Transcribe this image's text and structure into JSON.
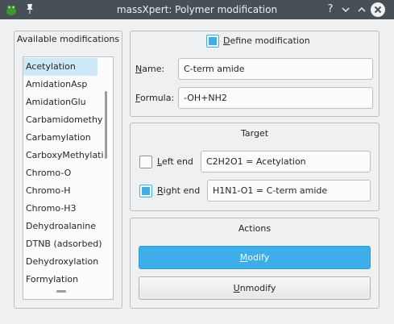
{
  "window": {
    "title": "massXpert: Polymer modification",
    "help_glyph": "?",
    "minimize_glyph": "⌄",
    "maximize_glyph": "⌃",
    "close_glyph": "✕"
  },
  "available": {
    "title": "Available modifications",
    "items": [
      {
        "label": "Acetylation",
        "selected": true
      },
      {
        "label": "AmidationAsp",
        "selected": false
      },
      {
        "label": "AmidationGlu",
        "selected": false
      },
      {
        "label": "Carbamidomethy",
        "selected": false
      },
      {
        "label": "Carbamylation",
        "selected": false
      },
      {
        "label": "CarboxyMethylati",
        "selected": false
      },
      {
        "label": "Chromo-O",
        "selected": false
      },
      {
        "label": "Chromo-H",
        "selected": false
      },
      {
        "label": "Chromo-H3",
        "selected": false
      },
      {
        "label": "Dehydroalanine",
        "selected": false
      },
      {
        "label": "DTNB (adsorbed)",
        "selected": false
      },
      {
        "label": "Dehydroxylation",
        "selected": false
      },
      {
        "label": "Formylation",
        "selected": false
      }
    ]
  },
  "define": {
    "checkbox_label_first": "D",
    "checkbox_label_rest": "efine modification",
    "checked": true,
    "name_label_first": "N",
    "name_label_rest": "ame:",
    "name_value": "C-term amide",
    "formula_label_first": "F",
    "formula_label_rest": "ormula:",
    "formula_value": "-OH+NH2"
  },
  "target": {
    "title": "Target",
    "left_label_first": "L",
    "left_label_rest": "eft end",
    "left_checked": false,
    "left_value": "C2H2O1 = Acetylation",
    "right_label_first": "R",
    "right_label_rest": "ight end",
    "right_checked": true,
    "right_value": "H1N1-O1 = C-term amide"
  },
  "actions": {
    "title": "Actions",
    "modify_first": "M",
    "modify_rest": "odify",
    "unmodify_first": "U",
    "unmodify_rest": "nmodify"
  },
  "colors": {
    "titlebar": "#475057",
    "accent": "#3daee9",
    "selection": "#cde8f8",
    "window_bg": "#eff0f1"
  }
}
